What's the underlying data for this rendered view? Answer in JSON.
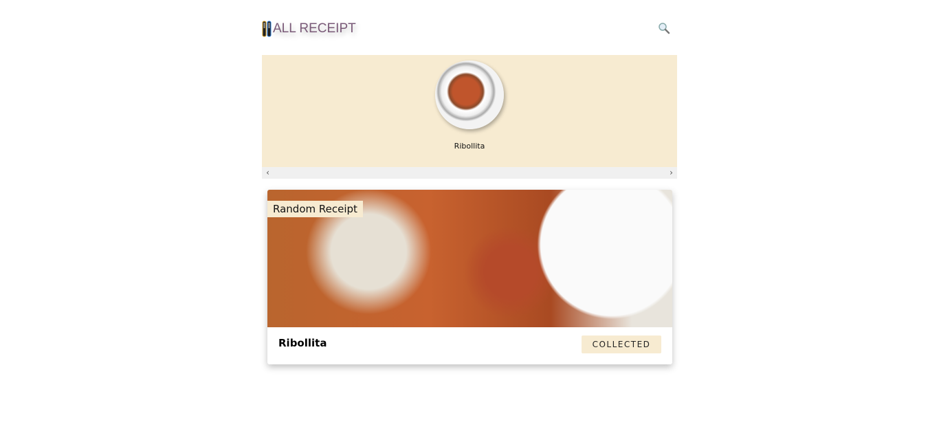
{
  "header": {
    "title": "ALL RECEIPT",
    "logo_icon": "fork-knife-icon",
    "search_icon": "search-icon"
  },
  "carousel": {
    "items": [
      {
        "label": "Ribollita"
      }
    ]
  },
  "card": {
    "tag": "Random Receipt",
    "title": "Ribollita",
    "button": "COLLECTED"
  },
  "colors": {
    "accent": "#f7ebd1",
    "title": "#7a5a78"
  }
}
